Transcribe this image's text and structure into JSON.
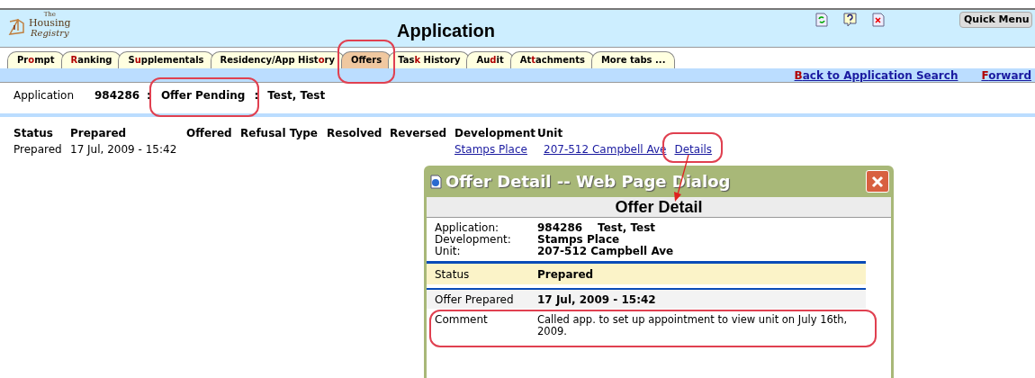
{
  "header": {
    "logo": {
      "line1": "The",
      "line2": "Housing",
      "line3": "Registry"
    },
    "title": "Application",
    "quick_menu": "Quick Menu"
  },
  "tabs": [
    {
      "parts": {
        "before": "Pr",
        "key": "o",
        "after": "mpt"
      },
      "selected": false
    },
    {
      "parts": {
        "key": "R",
        "after": "anking"
      },
      "selected": false
    },
    {
      "parts": {
        "before": "S",
        "key": "u",
        "after": "pplementals"
      },
      "selected": false
    },
    {
      "parts": {
        "before": "Residency/App Hist",
        "key": "o",
        "after": "ry"
      },
      "selected": false
    },
    {
      "parts": {
        "before": "Offers"
      },
      "selected": true
    },
    {
      "parts": {
        "before": "Tas",
        "key": "k",
        "after": " History"
      },
      "selected": false
    },
    {
      "parts": {
        "before": "Au",
        "key": "d",
        "after": "it"
      },
      "selected": false
    },
    {
      "parts": {
        "before": "At",
        "key": "t",
        "after": "achments"
      },
      "selected": false
    },
    {
      "parts": {
        "before": "More tabs ..."
      },
      "selected": false
    }
  ],
  "links": [
    {
      "parts": {
        "key": "B",
        "after": "ack to Application Search"
      }
    },
    {
      "parts": {
        "key": "F",
        "after": "orward"
      }
    }
  ],
  "summary": {
    "label": "Application",
    "number": "984286",
    "separator_1": ":",
    "status": "Offer Pending",
    "separator_2": ":",
    "name": "Test, Test"
  },
  "offers_table": {
    "columns": [
      "Status",
      "Prepared",
      "Offered",
      "Refusal Type",
      "Resolved",
      "Reversed",
      "Development",
      "Unit"
    ],
    "rows": [
      {
        "status": "Prepared",
        "prepared": "17 Jul, 2009 - 15:42",
        "development": "Stamps Place",
        "unit": "207-512 Campbell Ave",
        "action": "Details"
      }
    ]
  },
  "dialog": {
    "title": "Offer Detail -- Web Page Dialog",
    "heading": "Offer Detail",
    "info": [
      {
        "label": "Application:",
        "values": [
          "984286",
          "Test, Test"
        ]
      },
      {
        "label": "Development:",
        "values": [
          "Stamps Place"
        ]
      },
      {
        "label": "Unit:",
        "values": [
          "207-512 Campbell Ave"
        ]
      }
    ],
    "status": {
      "label": "Status",
      "value": "Prepared"
    },
    "details": [
      {
        "label": "Offer Prepared",
        "value": "17 Jul, 2009 - 15:42",
        "kind": "date"
      },
      {
        "label": "Comment",
        "value": "Called app. to set up appointment to view unit on July 16th, 2009.",
        "kind": "comment"
      }
    ]
  }
}
